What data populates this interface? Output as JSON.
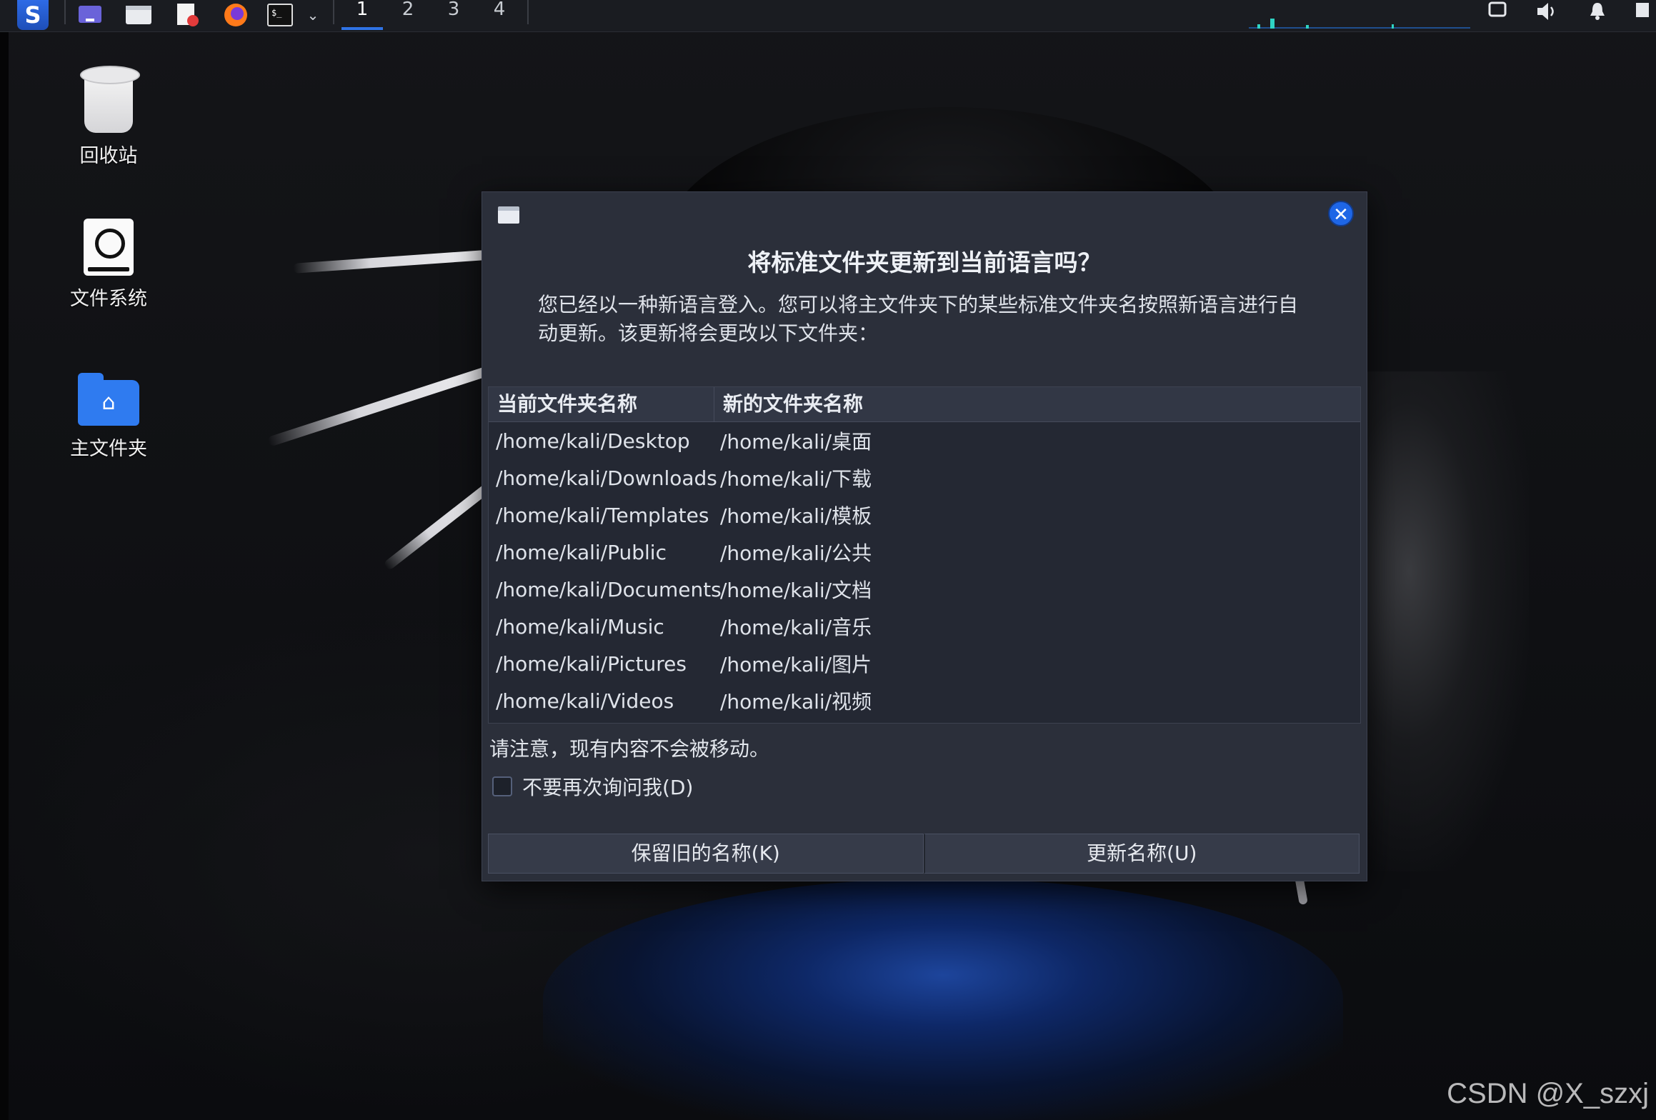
{
  "panel": {
    "workspaces": [
      "1",
      "2",
      "3",
      "4"
    ],
    "active_workspace": "1"
  },
  "desktop": {
    "icons": [
      {
        "label": "回收站",
        "icon": "trash-icon"
      },
      {
        "label": "文件系统",
        "icon": "filesystem-icon"
      },
      {
        "label": "主文件夹",
        "icon": "home-folder-icon"
      }
    ]
  },
  "dialog": {
    "title": "将标准文件夹更新到当前语言吗？",
    "description": "您已经以一种新语言登入。您可以将主文件夹下的某些标准文件夹名按照新语言进行自动更新。该更新将会更改以下文件夹：",
    "columns": [
      "当前文件夹名称",
      "新的文件夹名称"
    ],
    "rows": [
      [
        "/home/kali/Desktop",
        "/home/kali/桌面"
      ],
      [
        "/home/kali/Downloads",
        "/home/kali/下载"
      ],
      [
        "/home/kali/Templates",
        "/home/kali/模板"
      ],
      [
        "/home/kali/Public",
        "/home/kali/公共"
      ],
      [
        "/home/kali/Documents",
        "/home/kali/文档"
      ],
      [
        "/home/kali/Music",
        "/home/kali/音乐"
      ],
      [
        "/home/kali/Pictures",
        "/home/kali/图片"
      ],
      [
        "/home/kali/Videos",
        "/home/kali/视频"
      ]
    ],
    "note": "请注意，现有内容不会被移动。",
    "checkbox_label": "不要再次询问我(D)",
    "checkbox_checked": false,
    "keep_button": "保留旧的名称(K)",
    "update_button": "更新名称(U)",
    "close_glyph": "✕"
  },
  "watermark": "CSDN @X_szxj",
  "colors": {
    "accent": "#2f73e6",
    "dialog_bg": "#2b2f3a",
    "panel_bg": "#1a1c21"
  }
}
